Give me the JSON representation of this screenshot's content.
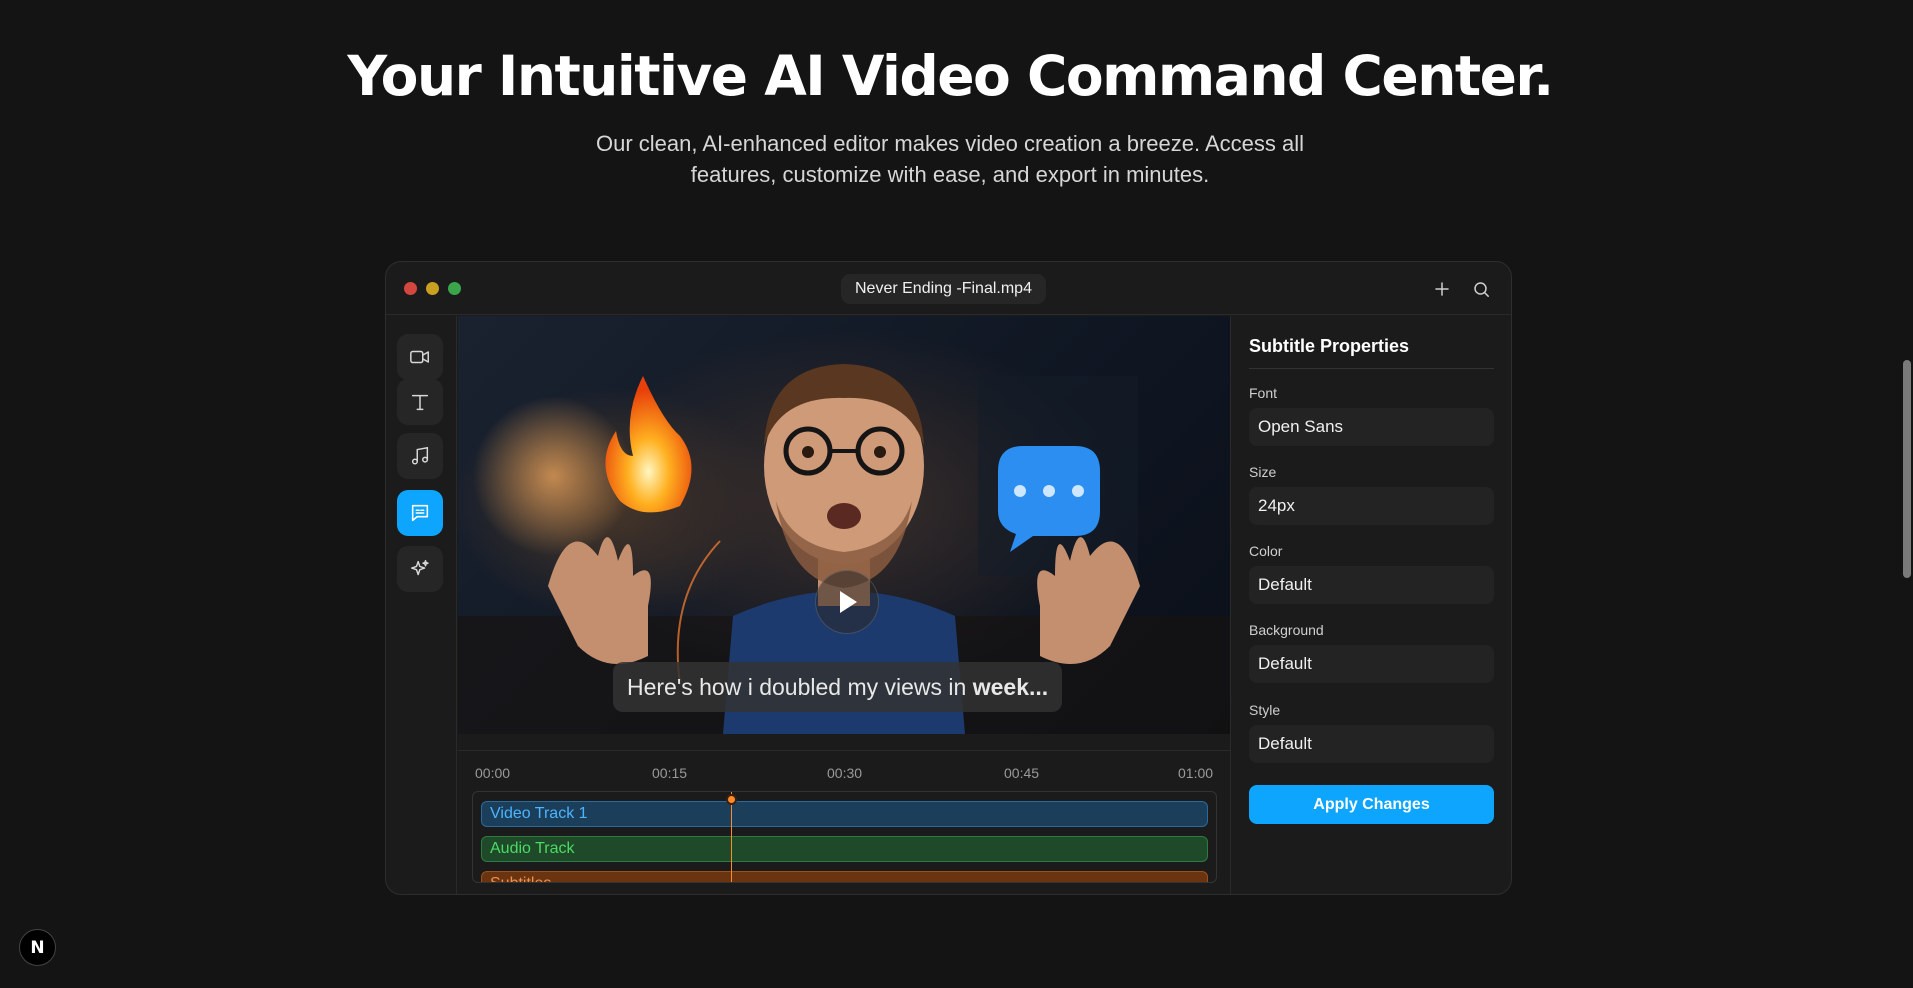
{
  "hero": {
    "title": "Your Intuitive AI Video Command Center.",
    "subtitle_line1": "Our clean, AI-enhanced editor makes video creation a breeze. Access all",
    "subtitle_line2": "features, customize with ease, and export in minutes."
  },
  "window": {
    "file_name": "Never Ending -Final.mp4",
    "title_actions": [
      "plus-icon",
      "search-icon"
    ]
  },
  "toolbar": {
    "tools": [
      {
        "icon": "video-camera-icon"
      },
      {
        "icon": "text-icon"
      },
      {
        "icon": "music-note-icon"
      },
      {
        "icon": "subtitles-icon",
        "active": true
      },
      {
        "icon": "sparkles-icon"
      }
    ]
  },
  "preview": {
    "caption_regular": "Here's how i doubled my views in ",
    "caption_bold": "week..."
  },
  "timeline": {
    "ticks": [
      "00:00",
      "00:15",
      "00:30",
      "00:45",
      "01:00"
    ],
    "tracks": [
      "Video Track 1",
      "Audio Track",
      "Subtitles"
    ]
  },
  "properties": {
    "title": "Subtitle Properties",
    "fields": [
      {
        "label": "Font",
        "value": "Open Sans"
      },
      {
        "label": "Size",
        "value": "24px"
      },
      {
        "label": "Color",
        "value": "Default"
      },
      {
        "label": "Background",
        "value": "Default"
      },
      {
        "label": "Style",
        "value": "Default"
      }
    ],
    "apply_label": "Apply Changes"
  },
  "badge": {
    "letter": "N"
  },
  "colors": {
    "accent": "#0ea5ff",
    "video_track": "#4db4ff",
    "audio_track": "#4cd964",
    "subtitle_track": "#f09050",
    "playhead": "#ff8a2a"
  }
}
